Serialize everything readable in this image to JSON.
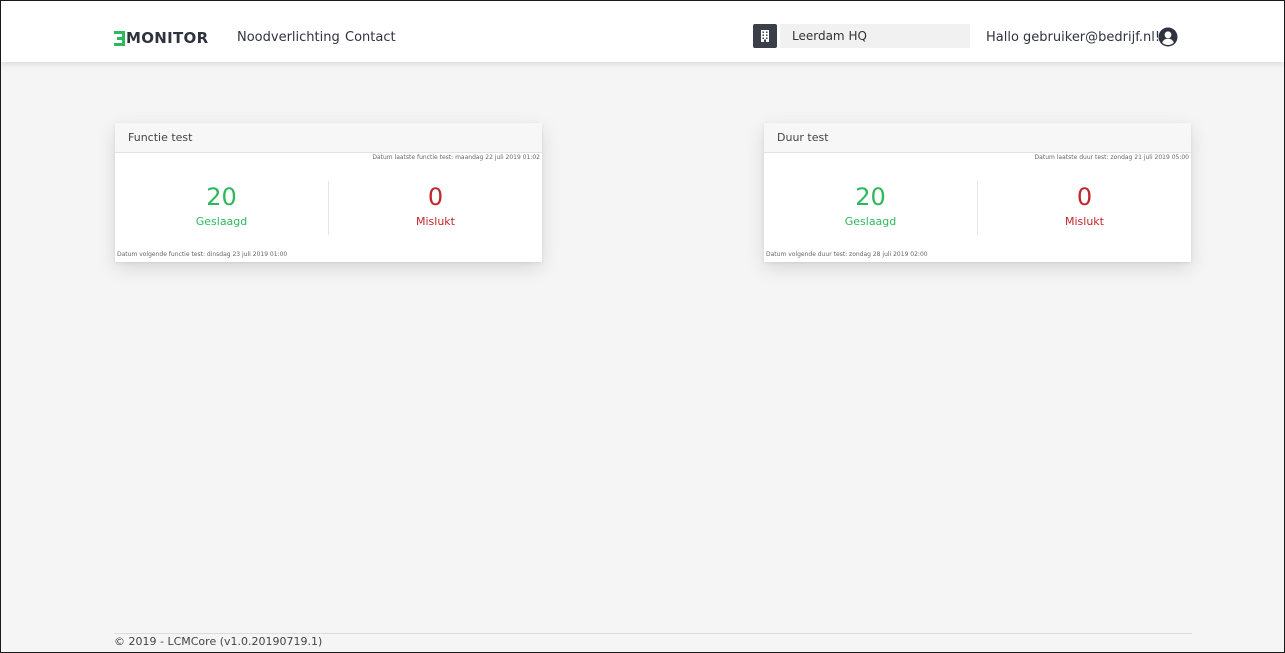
{
  "brand": {
    "logo_text": "MONITOR",
    "accent_color": "#2eb85c"
  },
  "nav": {
    "items": [
      {
        "label": "Noodverlichting"
      },
      {
        "label": "Contact"
      }
    ]
  },
  "location": {
    "icon": "building-icon",
    "value": "Leerdam HQ"
  },
  "user": {
    "greeting": "Hallo gebruiker@bedrijf.nl!",
    "icon": "user-circle-icon"
  },
  "cards": [
    {
      "title": "Functie test",
      "last_date": "Datum laatste functie test: maandag 22 juli 2019 01:02",
      "passed_value": "20",
      "passed_label": "Geslaagd",
      "failed_value": "0",
      "failed_label": "Mislukt",
      "next_date": "Datum volgende functie test: dinsdag 23 juli 2019 01:00"
    },
    {
      "title": "Duur test",
      "last_date": "Datum laatste duur test: zondag 21 juli 2019 05:00",
      "passed_value": "20",
      "passed_label": "Geslaagd",
      "failed_value": "0",
      "failed_label": "Mislukt",
      "next_date": "Datum volgende duur test: zondag 28 juli 2019 02:00"
    }
  ],
  "colors": {
    "success": "#2eb85c",
    "danger": "#c0272d"
  },
  "footer": {
    "text": "© 2019 - LCMCore (v1.0.20190719.1)"
  }
}
